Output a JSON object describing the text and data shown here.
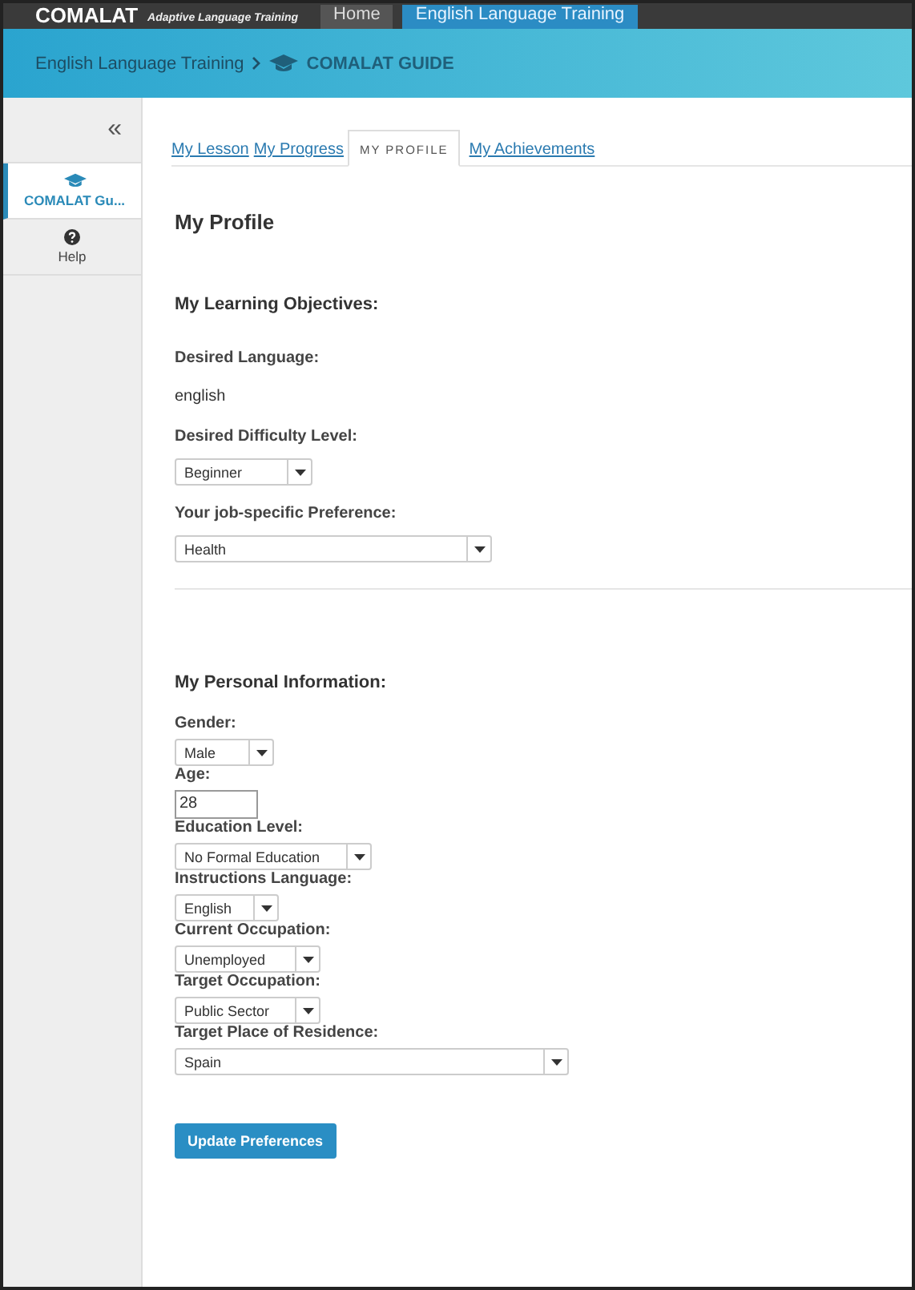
{
  "topbar": {
    "logo": "COMALAT",
    "tagline": "Adaptive Language Training",
    "nav": [
      {
        "label": "Home",
        "selected": false
      },
      {
        "label": "English Language Training",
        "selected": true
      }
    ]
  },
  "breadcrumb": {
    "items": [
      "English Language Training",
      "COMALAT GUIDE"
    ]
  },
  "sidebar": {
    "collapse": "«",
    "items": [
      {
        "label": "COMALAT Gu...",
        "selected": true
      },
      {
        "label": "Help",
        "selected": false
      }
    ]
  },
  "tabs": [
    {
      "label": "My Lesson",
      "selected": false
    },
    {
      "label": "My Progress",
      "selected": false
    },
    {
      "label": "MY PROFILE",
      "selected": true
    },
    {
      "label": "My Achievements",
      "selected": false
    }
  ],
  "title": "My Profile",
  "objectives": {
    "heading": "My Learning Objectives:",
    "fields": [
      {
        "label": "Desired Language:",
        "kind": "text",
        "value": "english"
      },
      {
        "label": "Desired Difficulty Level:",
        "kind": "select",
        "value": "Beginner"
      },
      {
        "label": "Your job-specific Preference:",
        "kind": "select",
        "value": "Health"
      }
    ]
  },
  "personal": {
    "heading": "My Personal Information:",
    "fields": [
      {
        "label": "Gender:",
        "kind": "select",
        "value": "Male"
      },
      {
        "label": "Age:",
        "kind": "input",
        "value": "28"
      },
      {
        "label": "Education Level:",
        "kind": "select",
        "value": "No Formal Education"
      },
      {
        "label": "Instructions Language:",
        "kind": "select",
        "value": "English"
      },
      {
        "label": "Current Occupation:",
        "kind": "select",
        "value": "Unemployed"
      },
      {
        "label": "Target Occupation:",
        "kind": "select",
        "value": "Public Sector"
      },
      {
        "label": "Target Place of Residence:",
        "kind": "select",
        "value": "Spain"
      }
    ]
  },
  "button": "Update Preferences"
}
